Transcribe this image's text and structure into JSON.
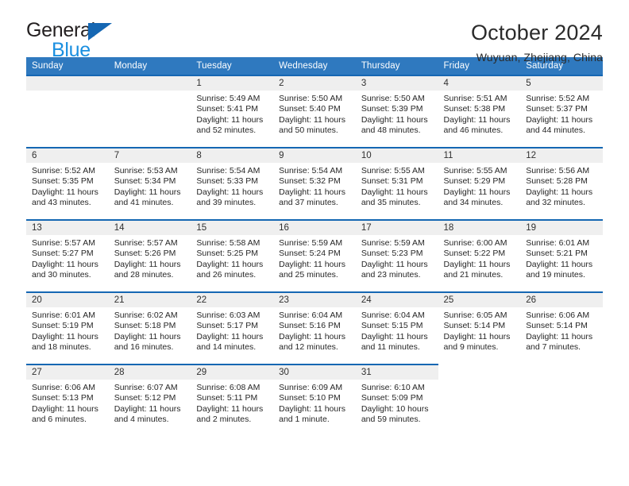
{
  "brand": {
    "name_top": "General",
    "name_bottom": "Blue",
    "triangle_color": "#1567b3",
    "blue_color": "#1a8fe0"
  },
  "header": {
    "title": "October 2024",
    "subtitle": "Wuyuan, Zhejiang, China"
  },
  "theme": {
    "header_bg": "#2f79bf",
    "row_border": "#1567b3",
    "daynum_band_bg": "#efefef"
  },
  "calendar": {
    "weekday_headers": [
      "Sunday",
      "Monday",
      "Tuesday",
      "Wednesday",
      "Thursday",
      "Friday",
      "Saturday"
    ],
    "weeks": [
      [
        {
          "day": "",
          "lines": []
        },
        {
          "day": "",
          "lines": []
        },
        {
          "day": "1",
          "lines": [
            "Sunrise: 5:49 AM",
            "Sunset: 5:41 PM",
            "Daylight: 11 hours and 52 minutes."
          ]
        },
        {
          "day": "2",
          "lines": [
            "Sunrise: 5:50 AM",
            "Sunset: 5:40 PM",
            "Daylight: 11 hours and 50 minutes."
          ]
        },
        {
          "day": "3",
          "lines": [
            "Sunrise: 5:50 AM",
            "Sunset: 5:39 PM",
            "Daylight: 11 hours and 48 minutes."
          ]
        },
        {
          "day": "4",
          "lines": [
            "Sunrise: 5:51 AM",
            "Sunset: 5:38 PM",
            "Daylight: 11 hours and 46 minutes."
          ]
        },
        {
          "day": "5",
          "lines": [
            "Sunrise: 5:52 AM",
            "Sunset: 5:37 PM",
            "Daylight: 11 hours and 44 minutes."
          ]
        }
      ],
      [
        {
          "day": "6",
          "lines": [
            "Sunrise: 5:52 AM",
            "Sunset: 5:35 PM",
            "Daylight: 11 hours and 43 minutes."
          ]
        },
        {
          "day": "7",
          "lines": [
            "Sunrise: 5:53 AM",
            "Sunset: 5:34 PM",
            "Daylight: 11 hours and 41 minutes."
          ]
        },
        {
          "day": "8",
          "lines": [
            "Sunrise: 5:54 AM",
            "Sunset: 5:33 PM",
            "Daylight: 11 hours and 39 minutes."
          ]
        },
        {
          "day": "9",
          "lines": [
            "Sunrise: 5:54 AM",
            "Sunset: 5:32 PM",
            "Daylight: 11 hours and 37 minutes."
          ]
        },
        {
          "day": "10",
          "lines": [
            "Sunrise: 5:55 AM",
            "Sunset: 5:31 PM",
            "Daylight: 11 hours and 35 minutes."
          ]
        },
        {
          "day": "11",
          "lines": [
            "Sunrise: 5:55 AM",
            "Sunset: 5:29 PM",
            "Daylight: 11 hours and 34 minutes."
          ]
        },
        {
          "day": "12",
          "lines": [
            "Sunrise: 5:56 AM",
            "Sunset: 5:28 PM",
            "Daylight: 11 hours and 32 minutes."
          ]
        }
      ],
      [
        {
          "day": "13",
          "lines": [
            "Sunrise: 5:57 AM",
            "Sunset: 5:27 PM",
            "Daylight: 11 hours and 30 minutes."
          ]
        },
        {
          "day": "14",
          "lines": [
            "Sunrise: 5:57 AM",
            "Sunset: 5:26 PM",
            "Daylight: 11 hours and 28 minutes."
          ]
        },
        {
          "day": "15",
          "lines": [
            "Sunrise: 5:58 AM",
            "Sunset: 5:25 PM",
            "Daylight: 11 hours and 26 minutes."
          ]
        },
        {
          "day": "16",
          "lines": [
            "Sunrise: 5:59 AM",
            "Sunset: 5:24 PM",
            "Daylight: 11 hours and 25 minutes."
          ]
        },
        {
          "day": "17",
          "lines": [
            "Sunrise: 5:59 AM",
            "Sunset: 5:23 PM",
            "Daylight: 11 hours and 23 minutes."
          ]
        },
        {
          "day": "18",
          "lines": [
            "Sunrise: 6:00 AM",
            "Sunset: 5:22 PM",
            "Daylight: 11 hours and 21 minutes."
          ]
        },
        {
          "day": "19",
          "lines": [
            "Sunrise: 6:01 AM",
            "Sunset: 5:21 PM",
            "Daylight: 11 hours and 19 minutes."
          ]
        }
      ],
      [
        {
          "day": "20",
          "lines": [
            "Sunrise: 6:01 AM",
            "Sunset: 5:19 PM",
            "Daylight: 11 hours and 18 minutes."
          ]
        },
        {
          "day": "21",
          "lines": [
            "Sunrise: 6:02 AM",
            "Sunset: 5:18 PM",
            "Daylight: 11 hours and 16 minutes."
          ]
        },
        {
          "day": "22",
          "lines": [
            "Sunrise: 6:03 AM",
            "Sunset: 5:17 PM",
            "Daylight: 11 hours and 14 minutes."
          ]
        },
        {
          "day": "23",
          "lines": [
            "Sunrise: 6:04 AM",
            "Sunset: 5:16 PM",
            "Daylight: 11 hours and 12 minutes."
          ]
        },
        {
          "day": "24",
          "lines": [
            "Sunrise: 6:04 AM",
            "Sunset: 5:15 PM",
            "Daylight: 11 hours and 11 minutes."
          ]
        },
        {
          "day": "25",
          "lines": [
            "Sunrise: 6:05 AM",
            "Sunset: 5:14 PM",
            "Daylight: 11 hours and 9 minutes."
          ]
        },
        {
          "day": "26",
          "lines": [
            "Sunrise: 6:06 AM",
            "Sunset: 5:14 PM",
            "Daylight: 11 hours and 7 minutes."
          ]
        }
      ],
      [
        {
          "day": "27",
          "lines": [
            "Sunrise: 6:06 AM",
            "Sunset: 5:13 PM",
            "Daylight: 11 hours and 6 minutes."
          ]
        },
        {
          "day": "28",
          "lines": [
            "Sunrise: 6:07 AM",
            "Sunset: 5:12 PM",
            "Daylight: 11 hours and 4 minutes."
          ]
        },
        {
          "day": "29",
          "lines": [
            "Sunrise: 6:08 AM",
            "Sunset: 5:11 PM",
            "Daylight: 11 hours and 2 minutes."
          ]
        },
        {
          "day": "30",
          "lines": [
            "Sunrise: 6:09 AM",
            "Sunset: 5:10 PM",
            "Daylight: 11 hours and 1 minute."
          ]
        },
        {
          "day": "31",
          "lines": [
            "Sunrise: 6:10 AM",
            "Sunset: 5:09 PM",
            "Daylight: 10 hours and 59 minutes."
          ]
        },
        {
          "day": "",
          "lines": []
        },
        {
          "day": "",
          "lines": []
        }
      ]
    ]
  }
}
